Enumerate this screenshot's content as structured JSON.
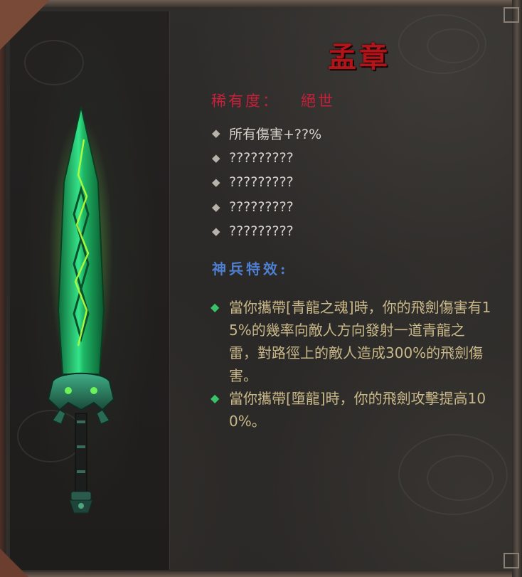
{
  "item": {
    "name": "孟章",
    "rarity_label": "稀有度：",
    "rarity_value": "絕世"
  },
  "stats": [
    "所有傷害+??%",
    "?????????",
    "?????????",
    "?????????",
    "?????????"
  ],
  "effects": {
    "title": "神兵特效:",
    "items": [
      "當你攜帶[青龍之魂]時，你的飛劍傷害有15%的幾率向敵人方向發射一道青龍之雷，對路徑上的敵人造成300%的飛劍傷害。",
      "當你攜帶[墮龍]時，你的飛劍攻擊提高100%。"
    ]
  },
  "colors": {
    "name": "#b3141a",
    "rarity": "#c8203a",
    "stat_text": "#d6d2cc",
    "effects_title": "#4f7fd0",
    "effect_text": "#c8b788",
    "effect_bullet": "#38c26a",
    "blade": "#2fd37a"
  },
  "icons": {
    "stat_bullet": "grey-diamond-icon",
    "effect_bullet": "green-diamond-icon",
    "item_image": "green-jade-sword-icon"
  }
}
